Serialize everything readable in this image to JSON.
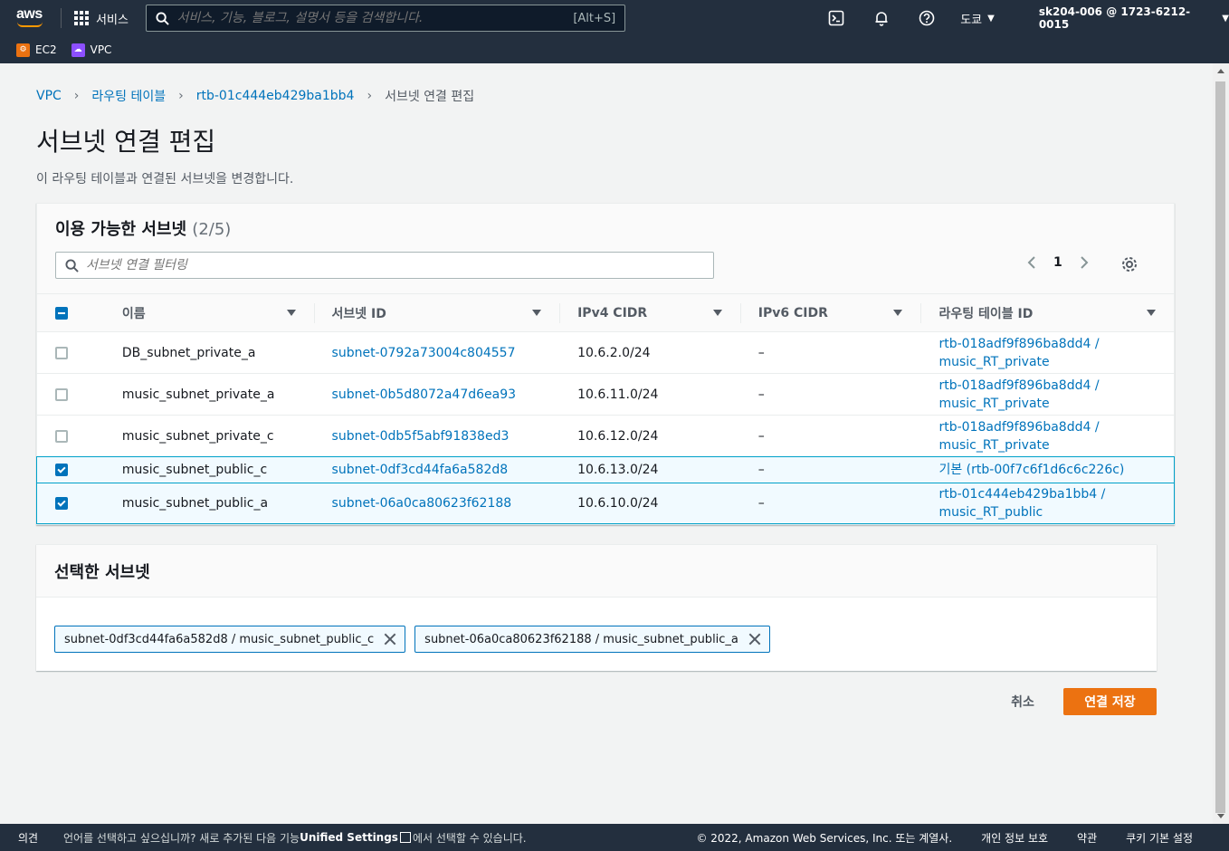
{
  "nav": {
    "logo_text": "aws",
    "services_label": "서비스",
    "search_placeholder": "서비스, 기능, 블로그, 설명서 등을 검색합니다.",
    "search_shortcut": "[Alt+S]",
    "region": "도쿄",
    "account": "sk204-006 @ 1723-6212-0015"
  },
  "favorites": [
    {
      "label": "EC2",
      "color": "#ec7211"
    },
    {
      "label": "VPC",
      "color": "#8c4fff"
    }
  ],
  "breadcrumb": {
    "items": [
      "VPC",
      "라우팅 테이블",
      "rtb-01c444eb429ba1bb4"
    ],
    "current": "서브넷 연결 편집"
  },
  "page": {
    "title": "서브넷 연결 편집",
    "description": "이 라우팅 테이블과 연결된 서브넷을 변경합니다."
  },
  "available": {
    "title": "이용 가능한 서브넷",
    "count": "(2/5)",
    "filter_placeholder": "서브넷 연결 필터링",
    "page": "1",
    "columns": [
      "이름",
      "서브넷 ID",
      "IPv4 CIDR",
      "IPv6 CIDR",
      "라우팅 테이블 ID"
    ],
    "rows": [
      {
        "name": "DB_subnet_private_a",
        "subnet_id": "subnet-0792a73004c804557",
        "ipv4": "10.6.2.0/24",
        "ipv6": "–",
        "rt_line1": "rtb-018adf9f896ba8dd4 /",
        "rt_line2": "music_RT_private",
        "checked": false
      },
      {
        "name": "music_subnet_private_a",
        "subnet_id": "subnet-0b5d8072a47d6ea93",
        "ipv4": "10.6.11.0/24",
        "ipv6": "–",
        "rt_line1": "rtb-018adf9f896ba8dd4 /",
        "rt_line2": "music_RT_private",
        "checked": false
      },
      {
        "name": "music_subnet_private_c",
        "subnet_id": "subnet-0db5f5abf91838ed3",
        "ipv4": "10.6.12.0/24",
        "ipv6": "–",
        "rt_line1": "rtb-018adf9f896ba8dd4 /",
        "rt_line2": "music_RT_private",
        "checked": false
      },
      {
        "name": "music_subnet_public_c",
        "subnet_id": "subnet-0df3cd44fa6a582d8",
        "ipv4": "10.6.13.0/24",
        "ipv6": "–",
        "rt_line1": "기본 (rtb-00f7c6f1d6c6c226c)",
        "rt_line2": "",
        "checked": true
      },
      {
        "name": "music_subnet_public_a",
        "subnet_id": "subnet-06a0ca80623f62188",
        "ipv4": "10.6.10.0/24",
        "ipv6": "–",
        "rt_line1": "rtb-01c444eb429ba1bb4 /",
        "rt_line2": "music_RT_public",
        "checked": true
      }
    ]
  },
  "selected": {
    "title": "선택한 서브넷",
    "tokens": [
      "subnet-0df3cd44fa6a582d8 / music_subnet_public_c",
      "subnet-06a0ca80623f62188 / music_subnet_public_a"
    ]
  },
  "actions": {
    "cancel": "취소",
    "save": "연결 저장"
  },
  "footer": {
    "feedback": "의견",
    "lang_prefix": "언어를 선택하고 싶으십니까? 새로 추가된 다음 기능",
    "lang_link": "Unified Settings",
    "lang_suffix": "에서 선택할 수 있습니다.",
    "copyright": "© 2022, Amazon Web Services, Inc. 또는 계열사.",
    "privacy": "개인 정보 보호",
    "terms": "약관",
    "cookies": "쿠키 기본 설정"
  }
}
